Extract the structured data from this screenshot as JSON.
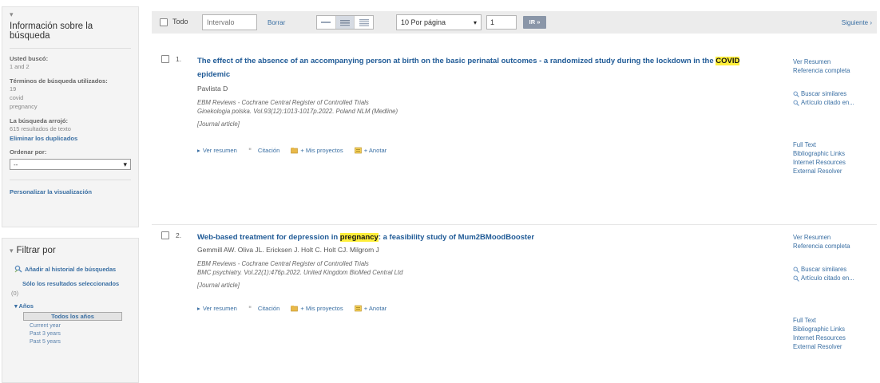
{
  "sidebar": {
    "info_title": "Información sobre la búsqueda",
    "you_searched_label": "Usted buscó:",
    "you_searched_value": "1 and 2",
    "terms_label": "Términos de búsqueda utilizados:",
    "terms": [
      "19",
      "covid",
      "pregnancy"
    ],
    "results_label": "La búsqueda arrojó:",
    "results_value": "615 resultados de texto",
    "remove_duplicates": "Eliminar los duplicados",
    "order_label": "Ordenar por:",
    "order_value": "--",
    "personalize": "Personalizar la visualización",
    "filter_title": "Filtrar por",
    "add_history": "Añadir al historial de búsquedas",
    "selected_only": "Sólo los resultados seleccionados",
    "selected_count": "(0)",
    "years_label": "Años",
    "all_years": "Todos los años",
    "year_options": [
      "Current year",
      "Past 3 years",
      "Past 5 years"
    ]
  },
  "toolbar": {
    "select_all_label": "Todo",
    "range_placeholder": "Intervalo",
    "clear_label": "Borrar",
    "per_page_value": "10 Por página",
    "page_number": "1",
    "go_label": "IR »",
    "next_label": "Siguiente ›"
  },
  "results": [
    {
      "number": "1.",
      "title_before": "The effect of the absence of an accompanying person at birth on the basic perinatal outcomes - a randomized study during the lockdown in the ",
      "title_highlight": "COVID",
      "title_after": " epidemic",
      "authors": "Pavlista D",
      "source": "EBM Reviews - Cochrane Central Register of Controlled Trials",
      "citation": "Ginekologia polska. Vol.93(12):1013-1017p.2022. Poland NLM (Medline)",
      "type": "[Journal article]"
    },
    {
      "number": "2.",
      "title_before": "Web-based treatment for depression in ",
      "title_highlight": "pregnancy",
      "title_after": ": a feasibility study of Mum2BMoodBooster",
      "authors": "Gemmill AW. Oliva JL. Ericksen J. Holt C. Holt CJ. Milgrom J",
      "source": "EBM Reviews - Cochrane Central Register of Controlled Trials",
      "citation": "BMC psychiatry. Vol.22(1):476p.2022. United Kingdom BioMed Central Ltd",
      "type": "[Journal article]"
    }
  ],
  "actions": {
    "view_abstract": "Ver resumen",
    "citation": "Citación",
    "my_projects": "+ Mis proyectos",
    "annotate": "+ Anotar"
  },
  "side_links": {
    "view_abstract": "Ver Resumen",
    "full_reference": "Referencia completa",
    "find_similar": "Buscar similares",
    "cited_by": "Artículo citado en...",
    "full_text": "Full Text",
    "bibliographic": "Bibliographic Links",
    "internet": "Internet Resources",
    "resolver": "External Resolver"
  },
  "colors": {
    "link": "#3a6fa3",
    "title": "#1f5a96",
    "highlight": "#ffef3a",
    "toolbar_bg": "#ececec",
    "sidebar_bg": "#f4f4f4"
  }
}
